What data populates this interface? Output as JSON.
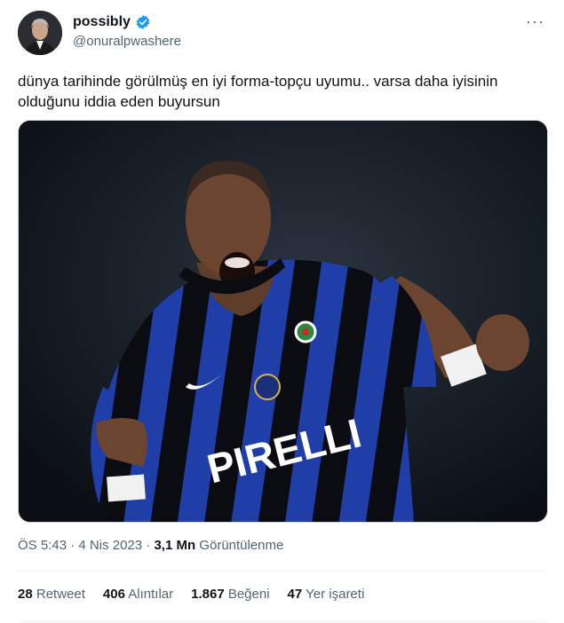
{
  "author": {
    "display_name": "possibly",
    "handle": "@onuralpwashere",
    "verified_icon": "verified-badge-icon",
    "avatar_icon": "avatar-image"
  },
  "more_icon": "more-options-icon",
  "more_glyph": "···",
  "tweet": {
    "text": "dünya tarihinde görülmüş en iyi forma-topçu uyumu.. varsa daha iyisinin olduğunu iddia eden buyursun"
  },
  "media": {
    "description_icon": "football-player-photo",
    "sponsor_text": "PIRELLI"
  },
  "meta": {
    "time": "ÖS 5:43",
    "sep1": " · ",
    "date": "4 Nis 2023",
    "sep2": " · ",
    "views_count": "3,1 Mn",
    "views_label": " Görüntülenme"
  },
  "stats": {
    "retweets_count": "28",
    "retweets_label": " Retweet",
    "quotes_count": "406",
    "quotes_label": " Alıntılar",
    "likes_count": "1.867",
    "likes_label": " Beğeni",
    "bookmarks_count": "47",
    "bookmarks_label": " Yer işareti"
  },
  "colors": {
    "verified_blue": "#1d9bf0",
    "secondary_text": "#536471",
    "primary_text": "#0f1419",
    "jersey_blue": "#1f3ea8",
    "jersey_black": "#0a0c12"
  }
}
